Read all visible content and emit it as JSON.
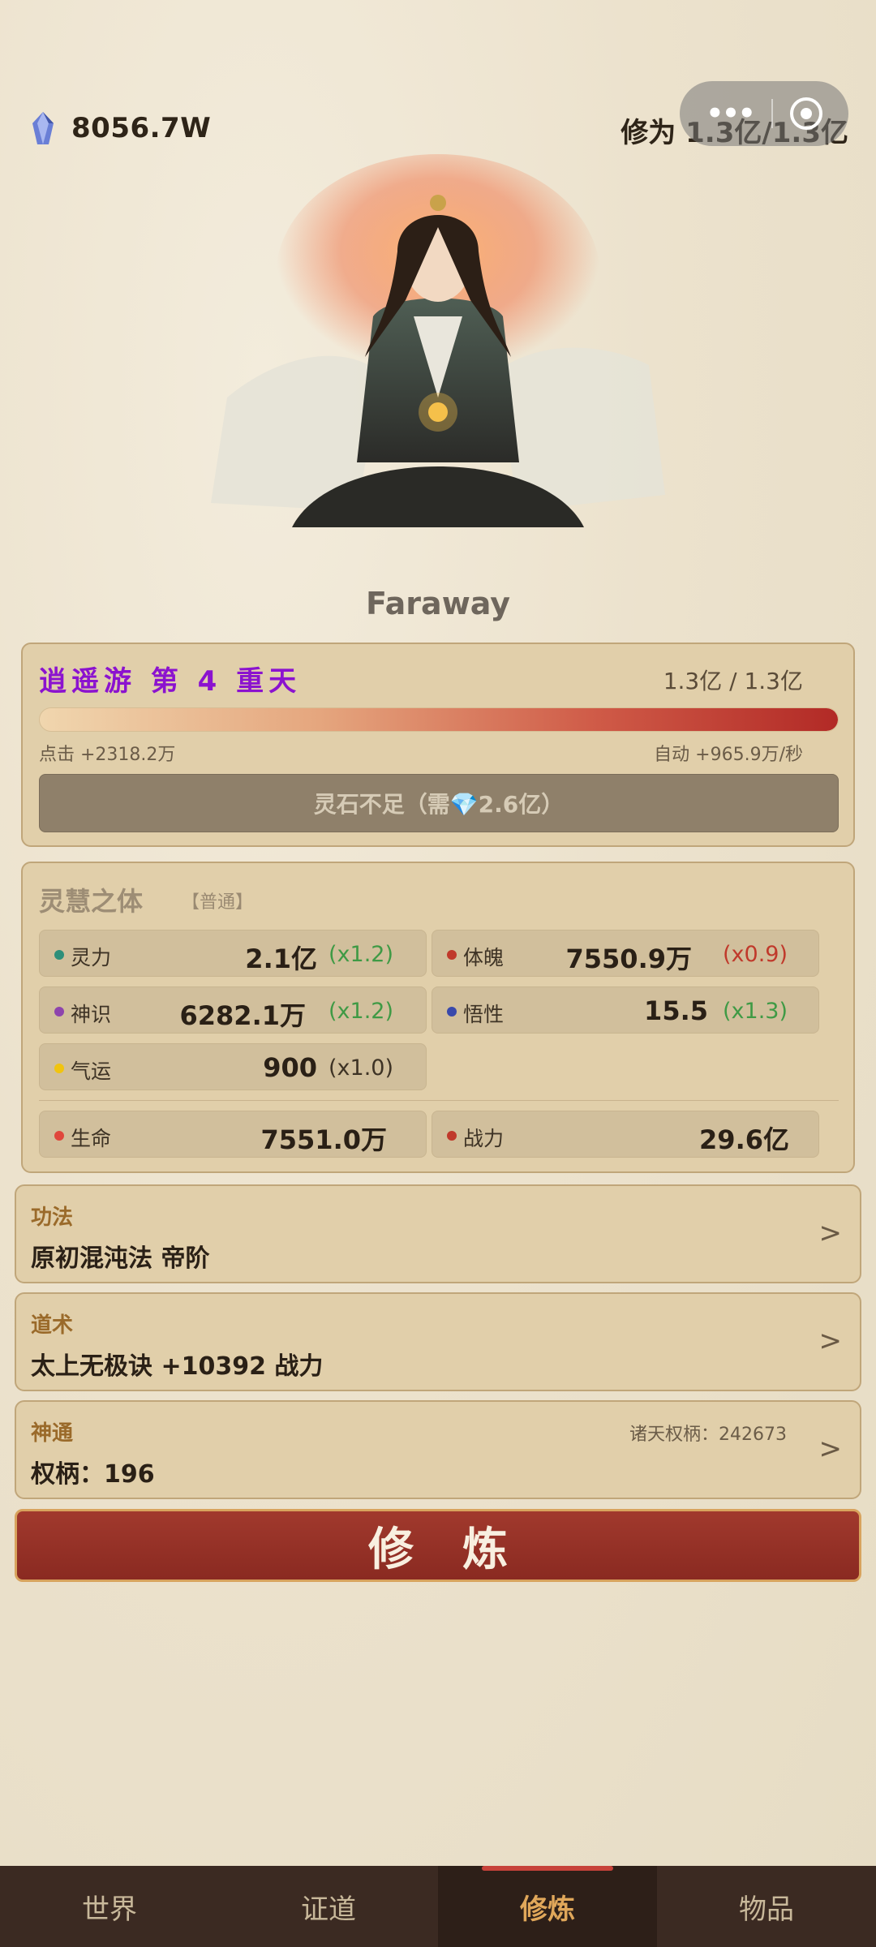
{
  "header": {
    "spirit_stones": "8056.7W",
    "cultivation_label": "修为 1.3亿/1.3亿"
  },
  "player": {
    "name": "Faraway"
  },
  "realm": {
    "title": "逍遥游  第 4 重天",
    "progress_text": "1.3亿 / 1.3亿",
    "progress_fraction": 1.0,
    "click_gain": "点击 +2318.2万",
    "auto_gain": "自动 +965.9万/秒",
    "breakthrough_label": "灵石不足（需💎2.6亿）"
  },
  "body": {
    "type": "灵慧之体",
    "grade": "【普通】",
    "stats": [
      {
        "label": "灵力",
        "value": "2.1亿",
        "mult": "(x1.2)",
        "dot_color": "#2e8f7a",
        "mult_color": "#3f9a45"
      },
      {
        "label": "体魄",
        "value": "7550.9万",
        "mult": "(x0.9)",
        "dot_color": "#c0392b",
        "mult_color": "#c0392b"
      },
      {
        "label": "神识",
        "value": "6282.1万",
        "mult": "(x1.2)",
        "dot_color": "#8e44ad",
        "mult_color": "#3f9a45"
      },
      {
        "label": "悟性",
        "value": "15.5",
        "mult": "(x1.3)",
        "dot_color": "#3949ab",
        "mult_color": "#3f9a45"
      },
      {
        "label": "气运",
        "value": "900",
        "mult": "(x1.0)",
        "dot_color": "#f1c40f",
        "mult_color": "#3e3325"
      }
    ],
    "life": {
      "label": "生命",
      "value": "7551.0万",
      "dot_color": "#e0473c"
    },
    "power": {
      "label": "战力",
      "value": "29.6亿",
      "dot_color": "#c0392b"
    }
  },
  "sections": {
    "technique": {
      "category": "功法",
      "value": "原初混沌法  帝阶"
    },
    "art": {
      "category": "道术",
      "value": "太上无极诀  +10392 战力"
    },
    "ability": {
      "category": "神通",
      "value": "权柄：196",
      "side": "诸天权柄：242673"
    },
    "chevron": ">"
  },
  "cultivate_button": "修炼",
  "nav": {
    "tabs": [
      "世界",
      "证道",
      "修炼",
      "物品"
    ],
    "active_index": 2
  }
}
